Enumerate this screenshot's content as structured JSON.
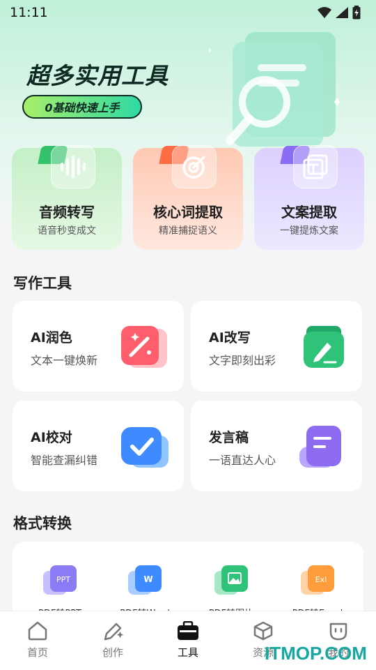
{
  "status_bar": {
    "time": "11:11"
  },
  "hero": {
    "title": "超多实用工具",
    "badge": "0基础快速上手"
  },
  "quick_tools": [
    {
      "title": "音频转写",
      "subtitle": "语音秒变成文",
      "icon": "sound-wave-icon",
      "color": "#33c26a"
    },
    {
      "title": "核心词提取",
      "subtitle": "精准捕捉语义",
      "icon": "target-icon",
      "color": "#ff6d44"
    },
    {
      "title": "文案提取",
      "subtitle": "一键提炼文案",
      "icon": "text-frame-icon",
      "color": "#8b6cf4"
    }
  ],
  "writing": {
    "title": "写作工具",
    "items": [
      {
        "title": "AI润色",
        "subtitle": "文本一键焕新",
        "icon": "magic-wand-icon",
        "color": "#ff5f6d"
      },
      {
        "title": "AI改写",
        "subtitle": "文字即刻出彩",
        "icon": "pen-icon",
        "color": "#2fc37a"
      },
      {
        "title": "AI校对",
        "subtitle": "智能查漏纠错",
        "icon": "check-icon",
        "color": "#3d8bff"
      },
      {
        "title": "发言稿",
        "subtitle": "一语直达人心",
        "icon": "document-icon",
        "color": "#8d6cf2"
      }
    ]
  },
  "format": {
    "title": "格式转换",
    "items": [
      {
        "label": "PDF转PPT",
        "badge": "PPT",
        "color": "#8b7cf6"
      },
      {
        "label": "PDF转Word",
        "badge": "W",
        "color": "#3d8bff"
      },
      {
        "label": "PDF转图片",
        "badge": "",
        "color": "#2fc37a"
      },
      {
        "label": "PDF转Excel",
        "badge": "Exl",
        "color": "#ff9d3d"
      }
    ]
  },
  "nav": [
    {
      "label": "首页",
      "icon": "home-icon",
      "active": false
    },
    {
      "label": "创作",
      "icon": "create-pen-icon",
      "active": false
    },
    {
      "label": "工具",
      "icon": "toolbox-icon",
      "active": true
    },
    {
      "label": "资源",
      "icon": "cube-icon",
      "active": false
    },
    {
      "label": "我的",
      "icon": "profile-icon",
      "active": false
    }
  ],
  "watermark": "ITMOP.COM"
}
